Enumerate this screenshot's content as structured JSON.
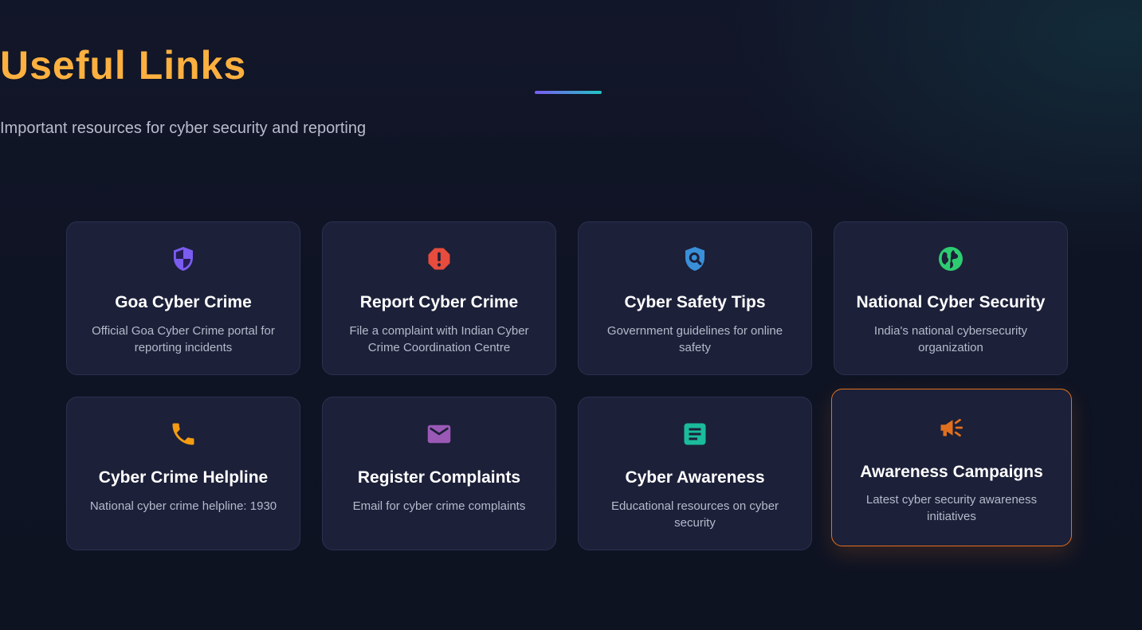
{
  "header": {
    "title": "Useful Links",
    "subtitle": "Important resources for cyber security and reporting"
  },
  "colors": {
    "title": "#fbb040",
    "card_bg": "#1c2039",
    "active_border": "#e0701f"
  },
  "cards": [
    {
      "title": "Goa Cyber Crime",
      "description": "Official Goa Cyber Crime portal for reporting incidents",
      "icon": "shield-icon",
      "icon_color": "#7b5cf0"
    },
    {
      "title": "Report Cyber Crime",
      "description": "File a complaint with Indian Cyber Crime Coordination Centre",
      "icon": "alert-octagon-icon",
      "icon_color": "#e74c3c"
    },
    {
      "title": "Cyber Safety Tips",
      "description": "Government guidelines for online safety",
      "icon": "shield-search-icon",
      "icon_color": "#3a8fd9"
    },
    {
      "title": "National Cyber Security",
      "description": "India's national cybersecurity organization",
      "icon": "globe-icon",
      "icon_color": "#2ecc71"
    },
    {
      "title": "Cyber Crime Helpline",
      "description": "National cyber crime helpline: 1930",
      "icon": "phone-icon",
      "icon_color": "#f39c12"
    },
    {
      "title": "Register Complaints",
      "description": "Email for cyber crime complaints",
      "icon": "envelope-icon",
      "icon_color": "#9b59b6"
    },
    {
      "title": "Cyber Awareness",
      "description": "Educational resources on cyber security",
      "icon": "document-icon",
      "icon_color": "#1abc9c"
    },
    {
      "title": "Awareness Campaigns",
      "description": "Latest cyber security awareness initiatives",
      "icon": "megaphone-icon",
      "icon_color": "#e0701f"
    }
  ]
}
